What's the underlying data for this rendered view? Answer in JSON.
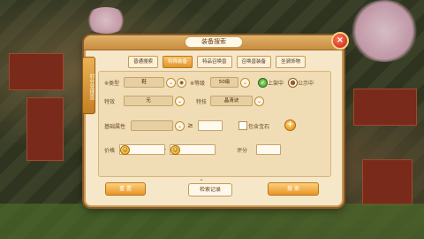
{
  "dialog": {
    "title": "装备搜索",
    "side_tag": "村分宠搜货",
    "close_glyph": "×"
  },
  "tabs": [
    {
      "label": "普通搜索"
    },
    {
      "label": "特殊装备"
    },
    {
      "label": "特品召唤兽"
    },
    {
      "label": "召唤兽装备"
    },
    {
      "label": "坐骑饰物"
    }
  ],
  "filters": {
    "type_label": "※类型",
    "type_value": "鞋",
    "level_label": "※等级",
    "level_value": "50级",
    "on_shelf_label": "上架中",
    "public_label": "公示中",
    "effect_label": "特效",
    "effect_value": "无",
    "skill_label": "特技",
    "skill_value": "晶清诀",
    "base_attr_label": "基础属性",
    "base_attr_value": "",
    "gte_symbol": "≥",
    "include_gem_label": "包含宝石",
    "price_label": "价格",
    "price_from": "",
    "price_to": "",
    "price_dash": "-",
    "score_label": "评分",
    "score_value": "",
    "expand_glyph": "⌄"
  },
  "buttons": {
    "reset": "重 置",
    "history": "检索记录",
    "search": "搜 索"
  },
  "icons": {
    "dropdown": "chevron-down-icon",
    "eye": "eye-icon",
    "coin": "coin-icon",
    "plus": "plus-icon"
  }
}
